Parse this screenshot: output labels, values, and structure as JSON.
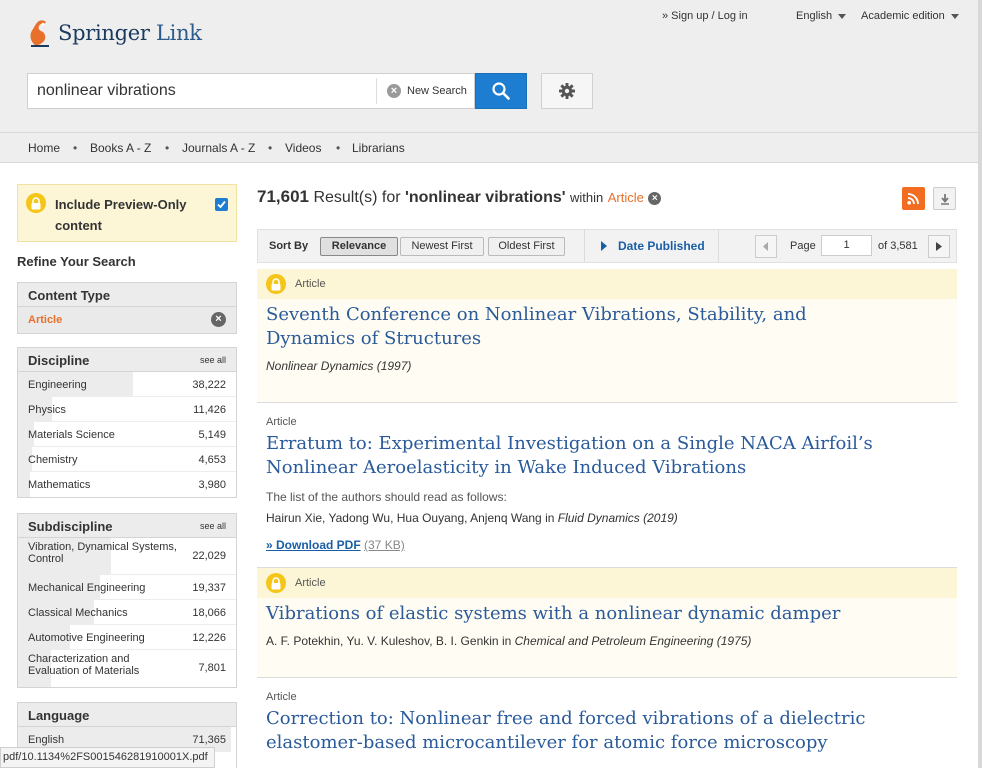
{
  "header": {
    "logo_brand": "Springer",
    "logo_sub": "Link",
    "login": "» Sign up / Log in",
    "language": "English",
    "edition": "Academic edition"
  },
  "search": {
    "value": "nonlinear vibrations",
    "new_search": "New Search",
    "icons": {
      "clear": "clear-icon",
      "submit": "search-icon",
      "settings": "gear-icon"
    }
  },
  "nav": [
    "Home",
    "Books A - Z",
    "Journals A - Z",
    "Videos",
    "Librarians"
  ],
  "sidebar": {
    "preview_label": "Include Preview-Only content",
    "preview_checked": true,
    "refine": "Refine Your Search",
    "content_type": {
      "title": "Content Type",
      "selected": "Article"
    },
    "discipline": {
      "title": "Discipline",
      "see_all": "see all",
      "items": [
        {
          "label": "Engineering",
          "count": "38,222"
        },
        {
          "label": "Physics",
          "count": "11,426"
        },
        {
          "label": "Materials Science",
          "count": "5,149"
        },
        {
          "label": "Chemistry",
          "count": "4,653"
        },
        {
          "label": "Mathematics",
          "count": "3,980"
        }
      ]
    },
    "subdiscipline": {
      "title": "Subdiscipline",
      "see_all": "see all",
      "items": [
        {
          "label_1": "Vibration, Dynamical Systems,",
          "label_2": "Control",
          "count": "22,029"
        },
        {
          "label_1": "Mechanical Engineering",
          "label_2": "",
          "count": "19,337"
        },
        {
          "label_1": "Classical Mechanics",
          "label_2": "",
          "count": "18,066"
        },
        {
          "label_1": "Automotive Engineering",
          "label_2": "",
          "count": "12,226"
        },
        {
          "label_1": "Characterization and",
          "label_2": "Evaluation of Materials",
          "count": "7,801"
        }
      ]
    },
    "language": {
      "title": "Language",
      "items": [
        {
          "label": "English",
          "count": "71,365"
        }
      ]
    }
  },
  "results": {
    "count": "71,601",
    "label": "Result(s) for",
    "query": "'nonlinear vibrations'",
    "within": "within",
    "scope": "Article",
    "sort_label": "Sort By",
    "sort_options": [
      "Relevance",
      "Newest First",
      "Oldest First"
    ],
    "sort_active": "Relevance",
    "date_filter": "Date Published",
    "page_label": "Page",
    "page_value": "1",
    "page_total": "of 3,581",
    "items": [
      {
        "type": "Article",
        "preview_only": true,
        "title_1": "Seventh Conference on Nonlinear Vibrations, Stability, and",
        "title_2": "Dynamics of Structures",
        "authors": "",
        "source": "Nonlinear Dynamics (1997)"
      },
      {
        "type": "Article",
        "preview_only": false,
        "title_1": "Erratum to: Experimental Investigation on a Single NACA Airfoil’s",
        "title_2": "Nonlinear Aeroelasticity in Wake Induced Vibrations",
        "snippet": "The list of the authors should read as follows:",
        "authors": "Hairun Xie, Yadong Wu, Hua Ouyang, Anjenq Wang",
        "in": "in",
        "source": "Fluid Dynamics (2019)",
        "pdf_label": "» Download PDF",
        "pdf_size": "(37 KB)"
      },
      {
        "type": "Article",
        "preview_only": true,
        "title_1": "Vibrations of elastic systems with a nonlinear dynamic damper",
        "authors": "A. F. Potekhin, Yu. V. Kuleshov, B. I. Genkin",
        "in": "in",
        "source": "Chemical and Petroleum Engineering (1975)"
      },
      {
        "type": "Article",
        "preview_only": false,
        "title_1": "Correction to: Nonlinear free and forced vibrations of a dielectric",
        "title_2": "elastomer-based microcantilever for atomic force microscopy"
      }
    ]
  },
  "statusbar": "pdf/10.1134%2FS001546281910001X.pdf",
  "colors": {
    "accent_orange": "#e8702a",
    "link_blue": "#2a5a9a",
    "button_blue": "#1d7dd1",
    "preview_yellow": "#fcf6d6",
    "lock_gold": "#f5c518"
  }
}
